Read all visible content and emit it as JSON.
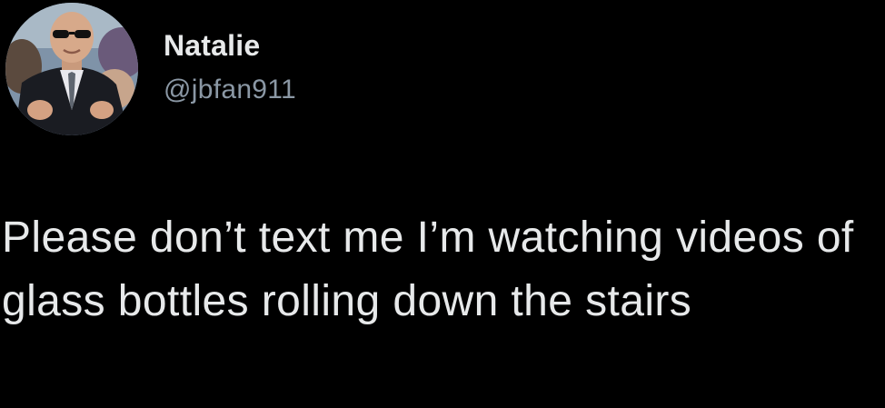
{
  "tweet": {
    "author": {
      "display_name": "Natalie",
      "handle": "@jbfan911",
      "avatar_icon": "profile-photo"
    },
    "text": "Please don’t text me I’m watching videos of glass bottles rolling down the stairs"
  },
  "colors": {
    "background": "#000000",
    "primary_text": "#e7e9ea",
    "secondary_text": "#8b98a5"
  }
}
